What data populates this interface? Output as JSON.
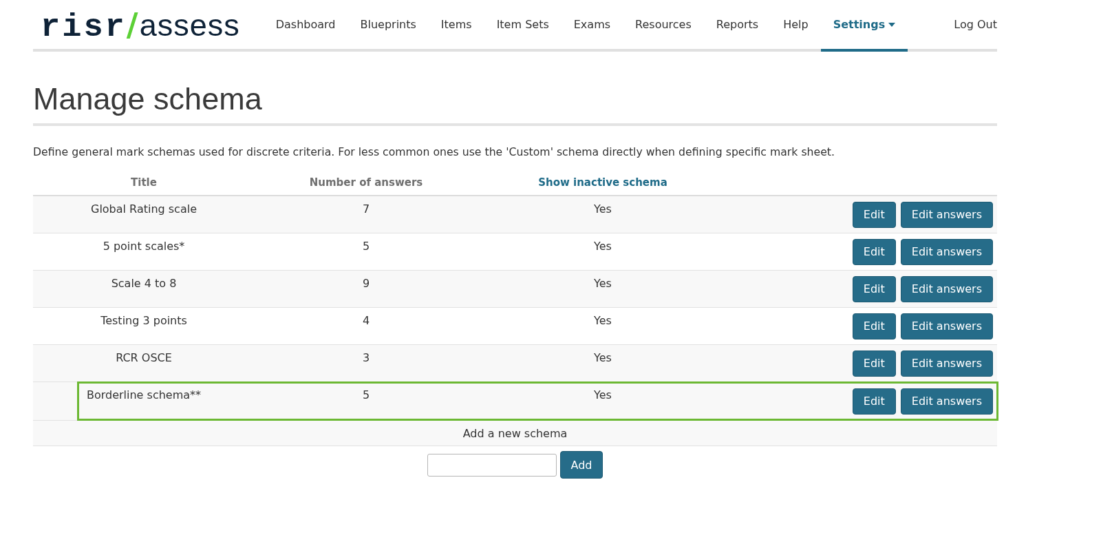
{
  "logo": {
    "strong": "risr",
    "separator": "/",
    "light": "assess"
  },
  "nav": {
    "items": [
      {
        "label": "Dashboard",
        "selected": false,
        "dropdown": false
      },
      {
        "label": "Blueprints",
        "selected": false,
        "dropdown": false
      },
      {
        "label": "Items",
        "selected": false,
        "dropdown": false
      },
      {
        "label": "Item Sets",
        "selected": false,
        "dropdown": false
      },
      {
        "label": "Exams",
        "selected": false,
        "dropdown": false
      },
      {
        "label": "Resources",
        "selected": false,
        "dropdown": false
      },
      {
        "label": "Reports",
        "selected": false,
        "dropdown": false
      },
      {
        "label": "Help",
        "selected": false,
        "dropdown": false
      },
      {
        "label": "Settings",
        "selected": true,
        "dropdown": true
      }
    ],
    "logout": "Log Out"
  },
  "page": {
    "title": "Manage schema",
    "description": "Define general mark schemas used for discrete criteria. For less common ones use the 'Custom' schema directly when defining specific mark sheet."
  },
  "table": {
    "columns": [
      {
        "label": "Title",
        "kind": "heading"
      },
      {
        "label": "Number of answers",
        "kind": "heading"
      },
      {
        "label": "Show inactive schema",
        "kind": "link"
      }
    ],
    "rows": [
      {
        "title": "Global Rating scale",
        "answers": "7",
        "column_3": "Yes",
        "actions": [
          "Edit",
          "Edit answers"
        ],
        "highlighted": false
      },
      {
        "title": "5 point scales*",
        "answers": "5",
        "column_3": "Yes",
        "actions": [
          "Edit",
          "Edit answers"
        ],
        "highlighted": false
      },
      {
        "title": "Scale 4 to 8",
        "answers": "9",
        "column_3": "Yes",
        "actions": [
          "Edit",
          "Edit answers"
        ],
        "highlighted": false
      },
      {
        "title": "Testing 3 points",
        "answers": "4",
        "column_3": "Yes",
        "actions": [
          "Edit",
          "Edit answers"
        ],
        "highlighted": false
      },
      {
        "title": "RCR OSCE",
        "answers": "3",
        "column_3": "Yes",
        "actions": [
          "Edit",
          "Edit answers"
        ],
        "highlighted": false
      },
      {
        "title": "Borderline schema**",
        "answers": "5",
        "column_3": "Yes",
        "actions": [
          "Edit",
          "Edit answers"
        ],
        "highlighted": true
      }
    ],
    "add_row": {
      "label": "Add a new schema",
      "button": "Add"
    }
  }
}
